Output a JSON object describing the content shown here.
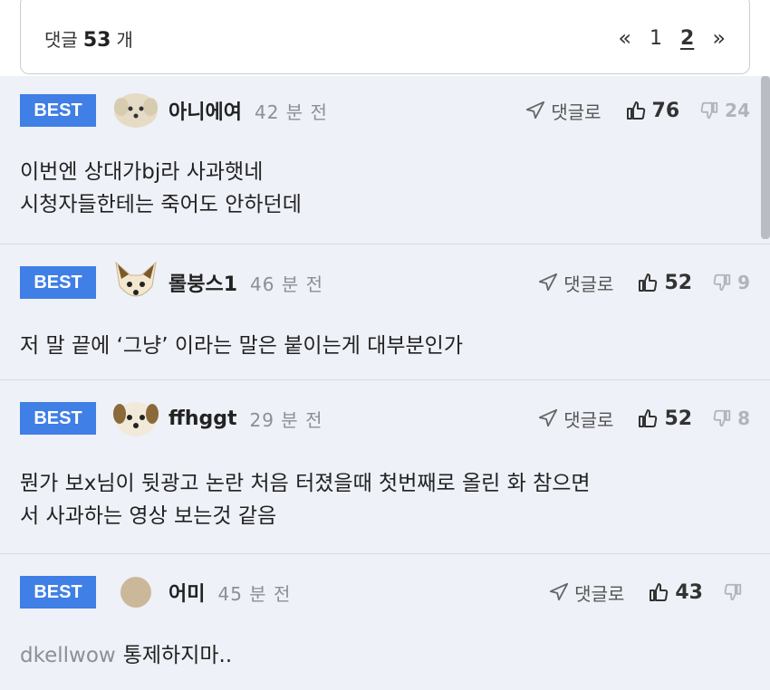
{
  "header": {
    "comment_label": "댓글",
    "comment_count": "53",
    "count_suffix": "개",
    "pager": {
      "prev": "«",
      "pages": [
        "1",
        "2"
      ],
      "current": "2",
      "next": "»"
    }
  },
  "labels": {
    "best": "BEST",
    "reply": "댓글로"
  },
  "colors": {
    "best_badge": "#3f7fe6",
    "background": "#eef1f7"
  },
  "comments": [
    {
      "user": "아니에여",
      "time": "42 분 전",
      "likes": "76",
      "dislikes": "24",
      "avatar": "puppy-avatar",
      "lines": [
        "이번엔 상대가bj라 사과햇네",
        "시청자들한테는 죽어도 안하던데"
      ],
      "mention": ""
    },
    {
      "user": "롤붕스1",
      "time": "46 분 전",
      "likes": "52",
      "dislikes": "9",
      "avatar": "fox-avatar",
      "lines": [
        "저 말 끝에 ‘그냥’ 이라는 말은 붙이는게 대부분인가"
      ],
      "mention": ""
    },
    {
      "user": "ffhggt",
      "time": "29 분 전",
      "likes": "52",
      "dislikes": "8",
      "avatar": "puppy-avatar",
      "lines": [
        "뭔가 보x님이 뒷광고 논란 처음 터졌을때 첫번째로 올린 화 참으면",
        "서 사과하는 영상 보는것 같음"
      ],
      "mention": ""
    },
    {
      "user": "어미",
      "time": "45 분 전",
      "likes": "43",
      "dislikes": "",
      "avatar": "round-avatar",
      "lines": [
        "통제하지마.."
      ],
      "mention": "dkellwow"
    }
  ]
}
